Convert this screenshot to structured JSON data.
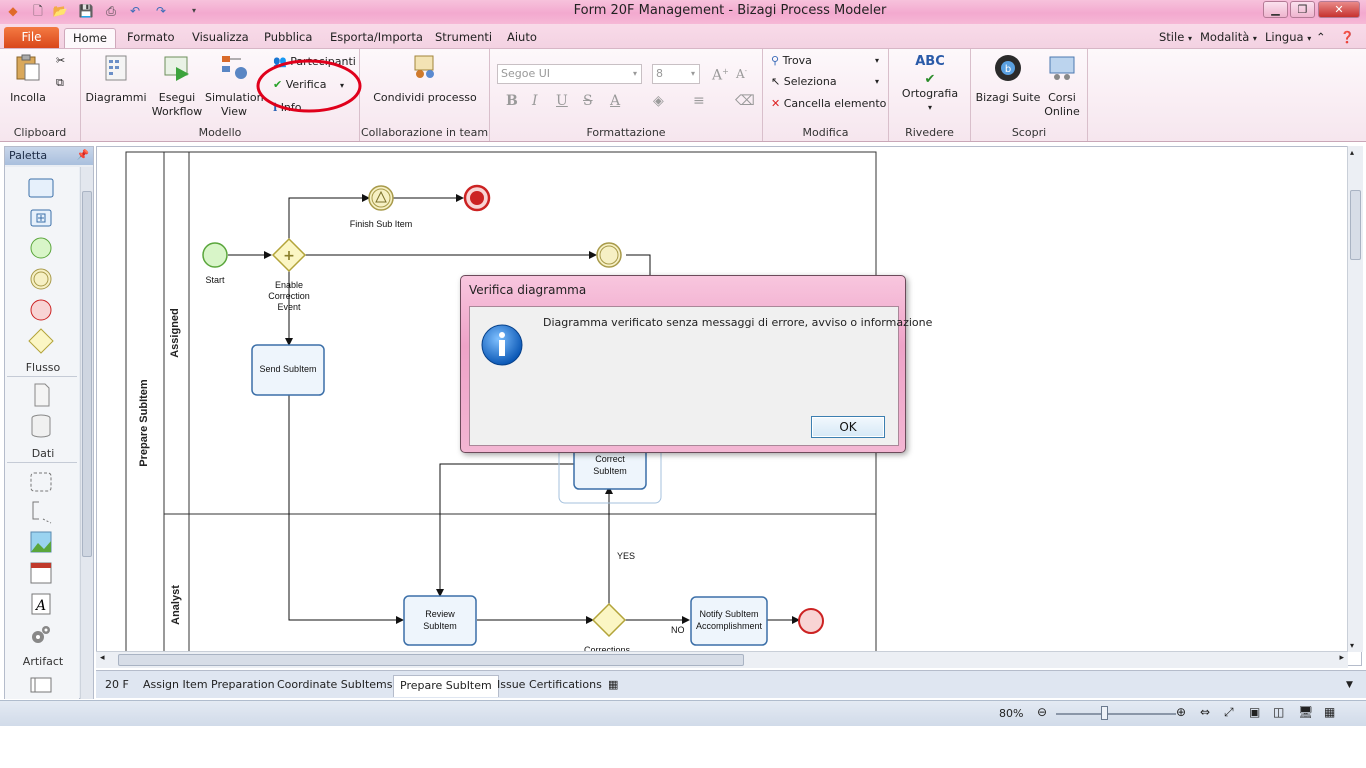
{
  "window": {
    "title": "Form 20F Management - Bizagi Process Modeler",
    "minimize_label": "▁",
    "restore_label": "❐",
    "close_label": "✕"
  },
  "ribbon_tabs": {
    "file": "File",
    "items": [
      "Home",
      "Formato",
      "Visualizza",
      "Pubblica",
      "Esporta/Importa",
      "Strumenti",
      "Aiuto"
    ],
    "right": [
      "Stile",
      "Modalità",
      "Lingua"
    ]
  },
  "ribbon": {
    "clipboard": {
      "paste": "Incolla",
      "group": "Clipboard"
    },
    "modello": {
      "diagrams": "Diagrammi",
      "run_workflow": "Esegui Workflow",
      "simulation": "Simulation View",
      "participants": "Partecipanti",
      "verify": "Verifica",
      "info": "Info",
      "group": "Modello"
    },
    "collab": {
      "share": "Condividi processo",
      "group": "Collaborazione in team"
    },
    "format": {
      "font": "Segoe UI",
      "size": "8",
      "group": "Formattazione"
    },
    "modify": {
      "find": "Trova",
      "select": "Seleziona",
      "delete": "Cancella elemento",
      "group": "Modifica"
    },
    "review": {
      "spelling": "Ortografia",
      "group": "Rivedere",
      "abc": "ABC"
    },
    "discover": {
      "suite": "Bizagi Suite",
      "courses": "Corsi Online",
      "group": "Scopri"
    }
  },
  "palette": {
    "title": "Paletta",
    "flow_caption": "Flusso",
    "data_caption": "Dati",
    "artifact_caption": "Artifact"
  },
  "diagram": {
    "pool": "Prepare SubItem",
    "lanes": [
      "Assigned",
      "Analyst"
    ],
    "labels": {
      "start": "Start",
      "finish_sub_item": "Finish Sub Item",
      "enable_1": "Enable",
      "enable_2": "Correction",
      "enable_3": "Event",
      "send_subitem": "Send SubItem",
      "correct_1": "Correct",
      "correct_2": "SubItem",
      "review_1": "Review",
      "review_2": "SubItem",
      "notify_1": "Notify SubItem",
      "notify_2": "Accomplishment",
      "yes": "YES",
      "no": "NO",
      "corrections": "Corrections"
    }
  },
  "doc_tabs": [
    "20 F",
    "Assign Item Preparation",
    "Coordinate SubItems",
    "Prepare SubItem",
    "Issue Certifications"
  ],
  "status": {
    "zoom": "80%",
    "zoom_level": 0.8
  },
  "dialog": {
    "title": "Verifica diagramma",
    "message": "Diagramma verificato senza messaggi di errore, avviso o informazione",
    "ok": "OK"
  },
  "colors": {
    "accent_pink": "#f3a9cf",
    "file_tab": "#e4592a",
    "highlight_circle": "#e0001b"
  }
}
